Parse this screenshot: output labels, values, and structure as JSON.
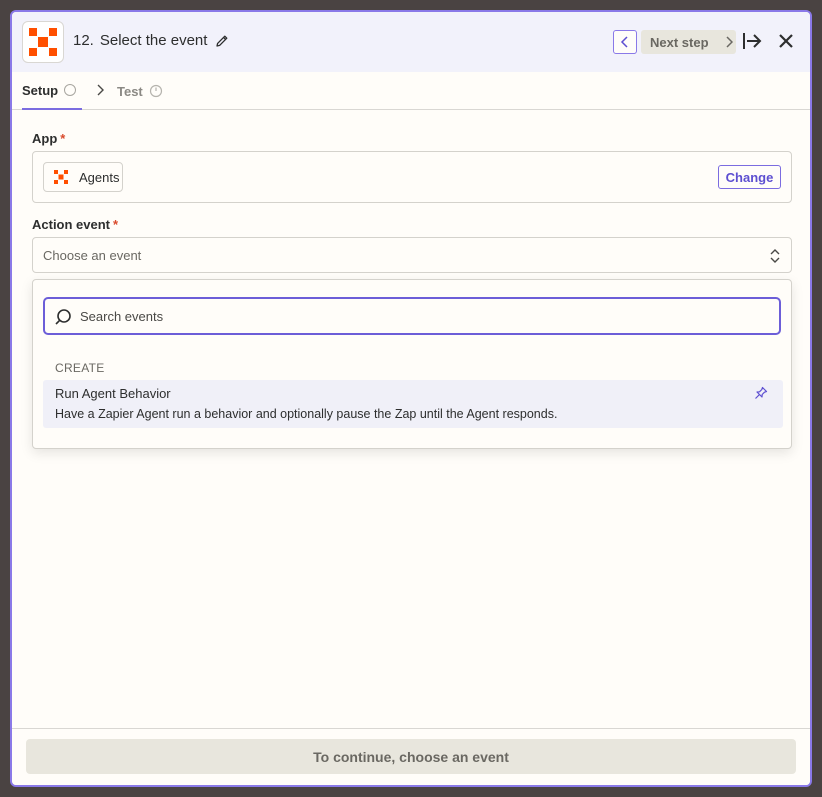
{
  "header": {
    "step_number": "12.",
    "title": "Select the event",
    "next_step_label": "Next step"
  },
  "tabs": {
    "setup": "Setup",
    "test": "Test"
  },
  "app_field": {
    "label": "App",
    "required_mark": "*",
    "app_name": "Agents",
    "change_label": "Change"
  },
  "action_field": {
    "label": "Action event",
    "required_mark": "*",
    "placeholder": "Choose an event"
  },
  "dropdown": {
    "search_placeholder": "Search events",
    "group_label": "CREATE",
    "items": [
      {
        "title": "Run Agent Behavior",
        "description": "Have a Zapier Agent run a behavior and optionally pause the Zap until the Agent responds."
      }
    ]
  },
  "footer": {
    "continue_label": "To continue, choose an event"
  },
  "colors": {
    "accent": "#7b6ce0",
    "brand": "#ff4f00",
    "required": "#d94a2c"
  }
}
